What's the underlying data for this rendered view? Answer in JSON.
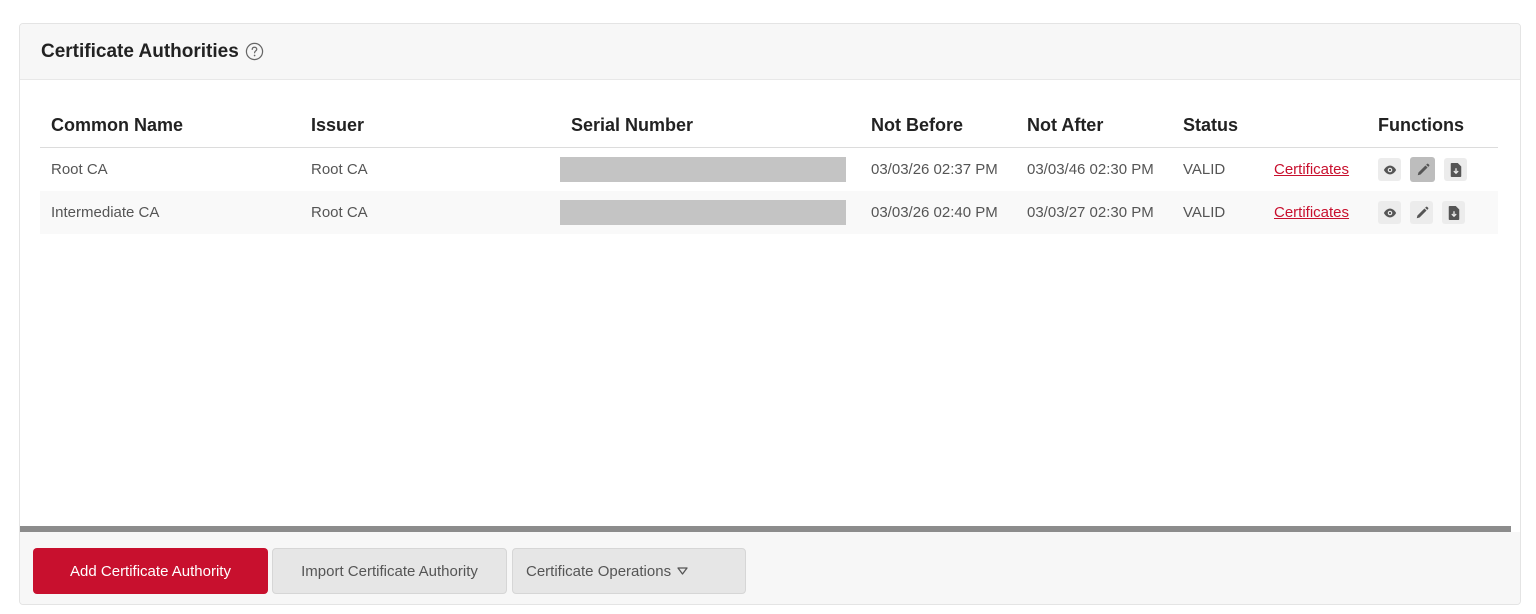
{
  "panel": {
    "title": "Certificate Authorities"
  },
  "table": {
    "columns": {
      "common_name": "Common Name",
      "issuer": "Issuer",
      "serial_number": "Serial Number",
      "not_before": "Not Before",
      "not_after": "Not After",
      "status": "Status",
      "links": "",
      "functions": "Functions"
    },
    "rows": [
      {
        "common_name": "Root CA",
        "issuer": "Root CA",
        "not_before": "03/03/26 02:37 PM",
        "not_after": "03/03/46 02:30 PM",
        "status": "VALID",
        "link_label": "Certificates"
      },
      {
        "common_name": "Intermediate CA",
        "issuer": "Root CA",
        "not_before": "03/03/26 02:40 PM",
        "not_after": "03/03/27 02:30 PM",
        "status": "VALID",
        "link_label": "Certificates"
      }
    ],
    "function_icons": [
      "eye-icon",
      "pencil-icon",
      "download-file-icon"
    ]
  },
  "footer": {
    "add_label": "Add Certificate Authority",
    "import_label": "Import Certificate Authority",
    "operations_label": "Certificate Operations"
  },
  "colors": {
    "accent": "#c8102e",
    "header_bg": "#f7f7f7",
    "redacted": "#c4c4c4"
  }
}
